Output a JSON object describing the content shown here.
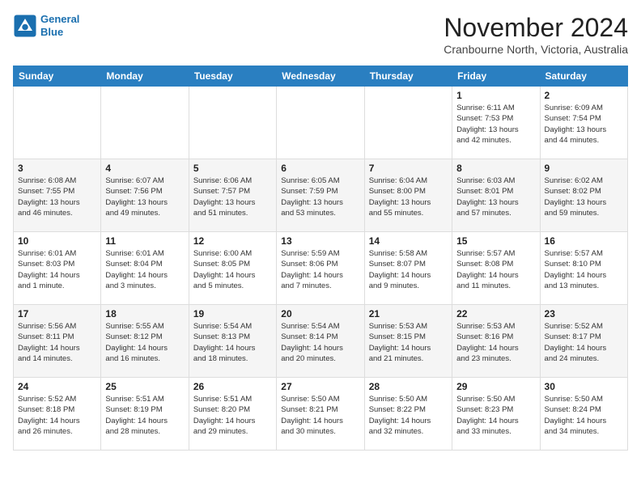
{
  "header": {
    "logo_line1": "General",
    "logo_line2": "Blue",
    "month": "November 2024",
    "location": "Cranbourne North, Victoria, Australia"
  },
  "weekdays": [
    "Sunday",
    "Monday",
    "Tuesday",
    "Wednesday",
    "Thursday",
    "Friday",
    "Saturday"
  ],
  "weeks": [
    [
      {
        "day": "",
        "info": ""
      },
      {
        "day": "",
        "info": ""
      },
      {
        "day": "",
        "info": ""
      },
      {
        "day": "",
        "info": ""
      },
      {
        "day": "",
        "info": ""
      },
      {
        "day": "1",
        "info": "Sunrise: 6:11 AM\nSunset: 7:53 PM\nDaylight: 13 hours\nand 42 minutes."
      },
      {
        "day": "2",
        "info": "Sunrise: 6:09 AM\nSunset: 7:54 PM\nDaylight: 13 hours\nand 44 minutes."
      }
    ],
    [
      {
        "day": "3",
        "info": "Sunrise: 6:08 AM\nSunset: 7:55 PM\nDaylight: 13 hours\nand 46 minutes."
      },
      {
        "day": "4",
        "info": "Sunrise: 6:07 AM\nSunset: 7:56 PM\nDaylight: 13 hours\nand 49 minutes."
      },
      {
        "day": "5",
        "info": "Sunrise: 6:06 AM\nSunset: 7:57 PM\nDaylight: 13 hours\nand 51 minutes."
      },
      {
        "day": "6",
        "info": "Sunrise: 6:05 AM\nSunset: 7:59 PM\nDaylight: 13 hours\nand 53 minutes."
      },
      {
        "day": "7",
        "info": "Sunrise: 6:04 AM\nSunset: 8:00 PM\nDaylight: 13 hours\nand 55 minutes."
      },
      {
        "day": "8",
        "info": "Sunrise: 6:03 AM\nSunset: 8:01 PM\nDaylight: 13 hours\nand 57 minutes."
      },
      {
        "day": "9",
        "info": "Sunrise: 6:02 AM\nSunset: 8:02 PM\nDaylight: 13 hours\nand 59 minutes."
      }
    ],
    [
      {
        "day": "10",
        "info": "Sunrise: 6:01 AM\nSunset: 8:03 PM\nDaylight: 14 hours\nand 1 minute."
      },
      {
        "day": "11",
        "info": "Sunrise: 6:01 AM\nSunset: 8:04 PM\nDaylight: 14 hours\nand 3 minutes."
      },
      {
        "day": "12",
        "info": "Sunrise: 6:00 AM\nSunset: 8:05 PM\nDaylight: 14 hours\nand 5 minutes."
      },
      {
        "day": "13",
        "info": "Sunrise: 5:59 AM\nSunset: 8:06 PM\nDaylight: 14 hours\nand 7 minutes."
      },
      {
        "day": "14",
        "info": "Sunrise: 5:58 AM\nSunset: 8:07 PM\nDaylight: 14 hours\nand 9 minutes."
      },
      {
        "day": "15",
        "info": "Sunrise: 5:57 AM\nSunset: 8:08 PM\nDaylight: 14 hours\nand 11 minutes."
      },
      {
        "day": "16",
        "info": "Sunrise: 5:57 AM\nSunset: 8:10 PM\nDaylight: 14 hours\nand 13 minutes."
      }
    ],
    [
      {
        "day": "17",
        "info": "Sunrise: 5:56 AM\nSunset: 8:11 PM\nDaylight: 14 hours\nand 14 minutes."
      },
      {
        "day": "18",
        "info": "Sunrise: 5:55 AM\nSunset: 8:12 PM\nDaylight: 14 hours\nand 16 minutes."
      },
      {
        "day": "19",
        "info": "Sunrise: 5:54 AM\nSunset: 8:13 PM\nDaylight: 14 hours\nand 18 minutes."
      },
      {
        "day": "20",
        "info": "Sunrise: 5:54 AM\nSunset: 8:14 PM\nDaylight: 14 hours\nand 20 minutes."
      },
      {
        "day": "21",
        "info": "Sunrise: 5:53 AM\nSunset: 8:15 PM\nDaylight: 14 hours\nand 21 minutes."
      },
      {
        "day": "22",
        "info": "Sunrise: 5:53 AM\nSunset: 8:16 PM\nDaylight: 14 hours\nand 23 minutes."
      },
      {
        "day": "23",
        "info": "Sunrise: 5:52 AM\nSunset: 8:17 PM\nDaylight: 14 hours\nand 24 minutes."
      }
    ],
    [
      {
        "day": "24",
        "info": "Sunrise: 5:52 AM\nSunset: 8:18 PM\nDaylight: 14 hours\nand 26 minutes."
      },
      {
        "day": "25",
        "info": "Sunrise: 5:51 AM\nSunset: 8:19 PM\nDaylight: 14 hours\nand 28 minutes."
      },
      {
        "day": "26",
        "info": "Sunrise: 5:51 AM\nSunset: 8:20 PM\nDaylight: 14 hours\nand 29 minutes."
      },
      {
        "day": "27",
        "info": "Sunrise: 5:50 AM\nSunset: 8:21 PM\nDaylight: 14 hours\nand 30 minutes."
      },
      {
        "day": "28",
        "info": "Sunrise: 5:50 AM\nSunset: 8:22 PM\nDaylight: 14 hours\nand 32 minutes."
      },
      {
        "day": "29",
        "info": "Sunrise: 5:50 AM\nSunset: 8:23 PM\nDaylight: 14 hours\nand 33 minutes."
      },
      {
        "day": "30",
        "info": "Sunrise: 5:50 AM\nSunset: 8:24 PM\nDaylight: 14 hours\nand 34 minutes."
      }
    ]
  ]
}
